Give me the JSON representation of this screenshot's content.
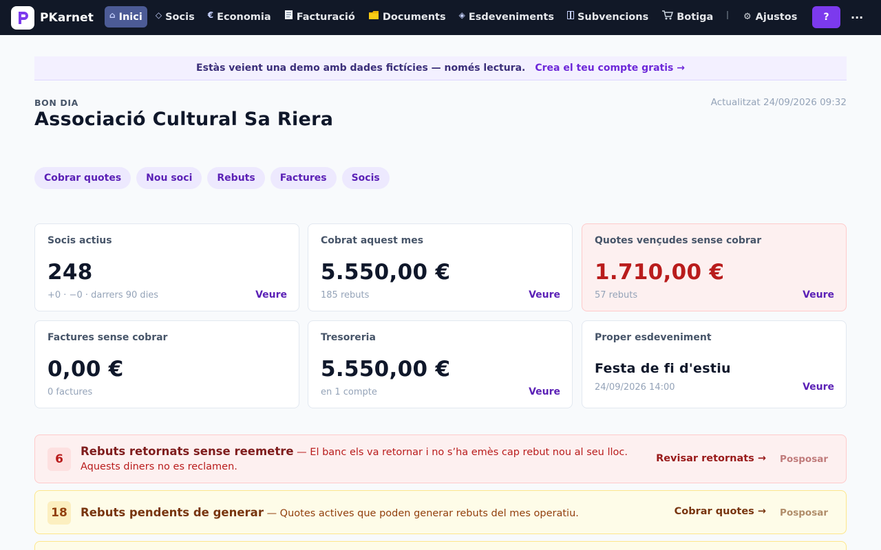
{
  "brand": {
    "name": "PKarnet",
    "logo_letter": "P"
  },
  "nav": {
    "items": [
      {
        "label": "Inici",
        "icon": "home-icon",
        "glyph": "⌂",
        "active": true
      },
      {
        "label": "Socis",
        "icon": "diamond-icon",
        "glyph": "◇"
      },
      {
        "label": "Economia",
        "icon": "euro-icon",
        "glyph": "€"
      },
      {
        "label": "Facturació",
        "icon": "receipt-icon",
        "glyph": "🧾"
      },
      {
        "label": "Documents",
        "icon": "folder-icon",
        "glyph": "🗂"
      },
      {
        "label": "Esdeveniments",
        "icon": "diamond-icon",
        "glyph": "◈"
      },
      {
        "label": "Subvencions",
        "icon": "book-icon",
        "glyph": "▯"
      },
      {
        "label": "Botiga",
        "icon": "cart-icon",
        "glyph": "🛒"
      }
    ],
    "settings_label": "Ajustos",
    "help_label": "?",
    "more_label": "..."
  },
  "banner": {
    "text": "Estàs veient una demo amb dades fictícies — només lectura.",
    "link": "Crea el teu compte gratis →"
  },
  "header": {
    "greeting": "BON DIA",
    "org_name": "Associació Cultural Sa Riera",
    "updated": "Actualitzat 24/09/2026 09:32"
  },
  "quick_actions": [
    "Cobrar quotes",
    "Nou soci",
    "Rebuts",
    "Factures",
    "Socis"
  ],
  "cards": [
    {
      "title": "Socis actius",
      "value": "248",
      "sub": "+0 · −0 · darrers 90 dies",
      "link": "Veure"
    },
    {
      "title": "Cobrat aquest mes",
      "value": "5.550,00 €",
      "sub": "185 rebuts",
      "link": "Veure"
    },
    {
      "title": "Quotes vençudes sense cobrar",
      "value": "1.710,00 €",
      "sub": "57 rebuts",
      "link": "Veure"
    },
    {
      "title": "Factures sense cobrar",
      "value": "0,00 €",
      "sub": "0 factures",
      "link": ""
    },
    {
      "title": "Tresoreria",
      "value": "5.550,00 €",
      "sub": "en 1 compte",
      "link": "Veure"
    },
    {
      "title": "Proper esdeveniment",
      "value": "Festa de fi d'estiu",
      "sub": "24/09/2026 14:00",
      "link": "Veure"
    }
  ],
  "alerts": [
    {
      "count": "6",
      "title": "Rebuts retornats sense reemetre",
      "desc": "— El banc els va retornar i no s’ha emès cap rebut nou al seu lloc. Aquests diners no es reclamen.",
      "action": "Revisar retornats →",
      "dismiss": "Posposar",
      "color": "#b91c1c"
    },
    {
      "count": "18",
      "title": "Rebuts pendents de generar",
      "desc": "— Quotes actives que poden generar rebuts del mes operatiu.",
      "action": "Cobrar quotes →",
      "dismiss": "Posposar",
      "color": "#92400e"
    }
  ],
  "colors": {
    "nav_bg": "#111827",
    "accent": "#5b21b6",
    "help_button": "#7c3aed",
    "alert_red": "#b91c1c",
    "alert_yellow": "#92400e"
  }
}
